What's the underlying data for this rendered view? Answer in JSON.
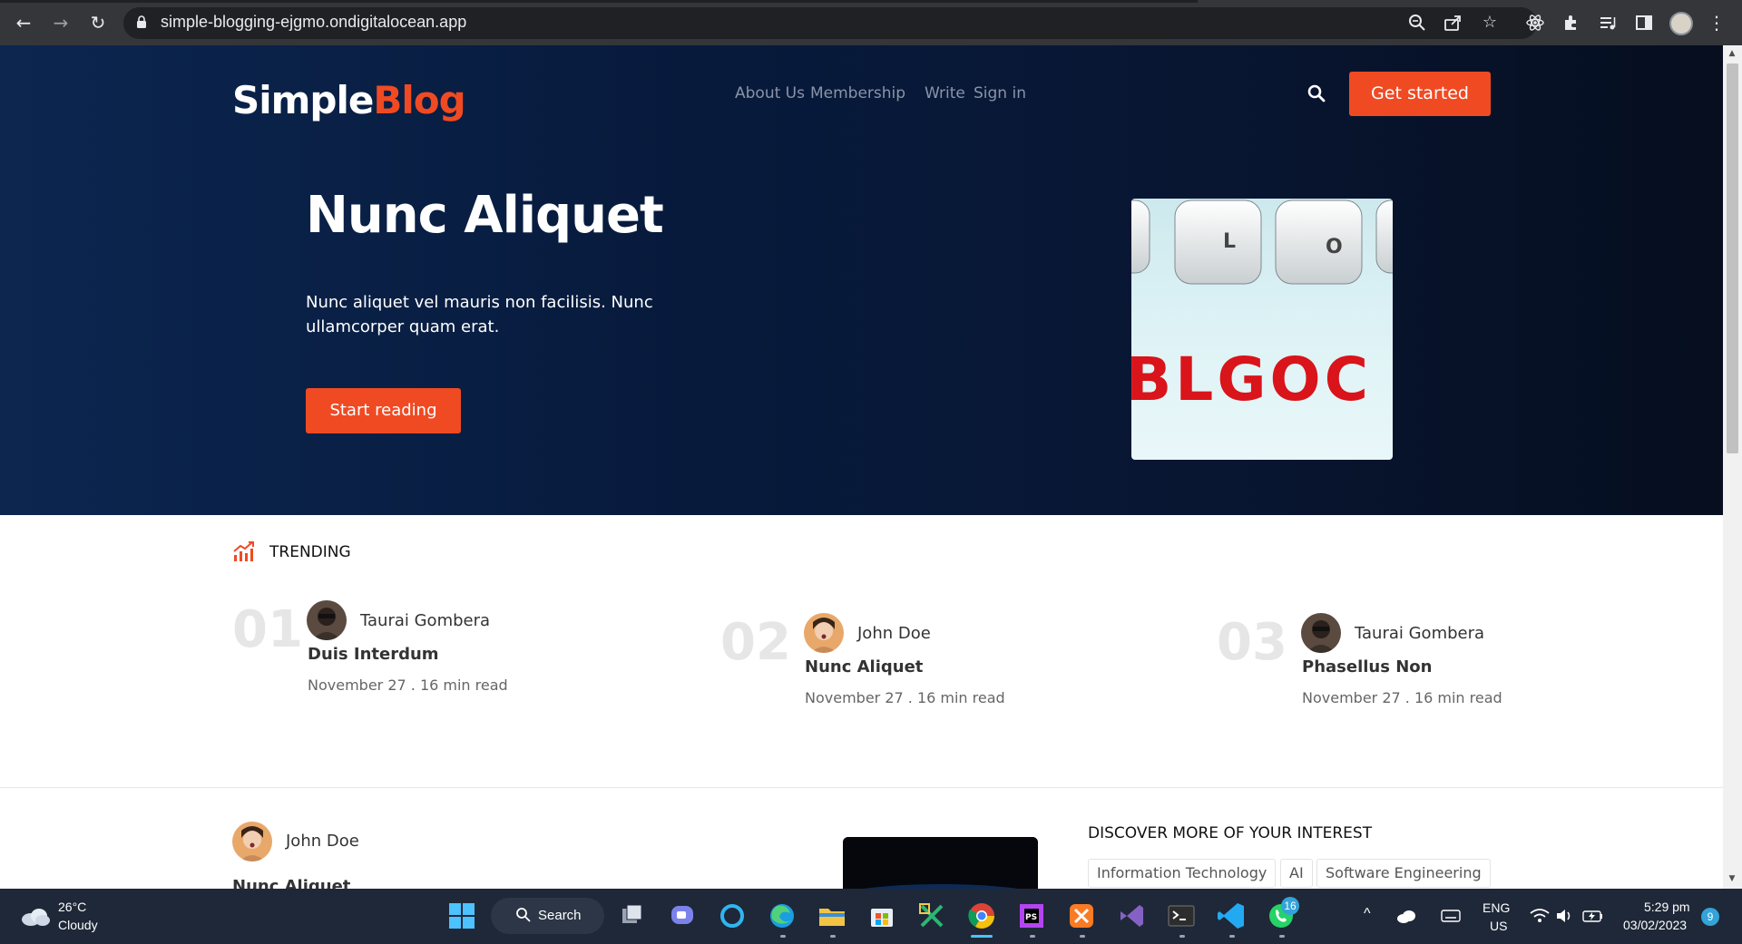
{
  "browser": {
    "url": "simple-blogging-ejgmo.ondigitalocean.app",
    "icons": [
      "back-arrow-icon",
      "forward-arrow-icon",
      "reload-icon",
      "lock-icon",
      "zoom-icon",
      "share-icon",
      "star-icon",
      "react-devtools-icon",
      "extensions-icon",
      "media-icon",
      "side-panel-icon",
      "profile-avatar-icon",
      "kebab-menu-icon"
    ]
  },
  "header": {
    "logo_part1": "Simple",
    "logo_part2": "Blog",
    "nav": [
      "About Us",
      "Membership",
      "Write",
      "Sign in"
    ],
    "cta": "Get started"
  },
  "hero": {
    "title": "Nunc Aliquet",
    "text": "Nunc aliquet vel mauris non facilisis. Nunc ullamcorper quam erat.",
    "button": "Start reading",
    "image_text_keys": [
      "L",
      "O"
    ],
    "image_text_big": "BLGOC"
  },
  "trending": {
    "label": "TRENDING",
    "items": [
      {
        "num": "01",
        "author": "Taurai Gombera",
        "title": "Duis Interdum",
        "meta": "November 27 . 16 min read"
      },
      {
        "num": "02",
        "author": "John Doe",
        "title": "Nunc Aliquet",
        "meta": "November 27 . 16 min read"
      },
      {
        "num": "03",
        "author": "Taurai Gombera",
        "title": "Phasellus Non",
        "meta": "November 27 . 16 min read"
      }
    ]
  },
  "feed": {
    "author": "John Doe",
    "title": "Nunc Aliquet"
  },
  "discover": {
    "heading": "DISCOVER MORE OF YOUR INTEREST",
    "tags": [
      "Information Technology",
      "AI",
      "Software Engineering"
    ]
  },
  "taskbar": {
    "temp": "26°C",
    "weather": "Cloudy",
    "search": "Search",
    "lang1": "ENG",
    "lang2": "US",
    "time": "5:29 pm",
    "date": "03/02/2023",
    "notif_count": "9",
    "whatsapp_count": "16"
  },
  "colors": {
    "accent": "#f04a23",
    "hero_bg": "#071a3c",
    "chrome_bg": "#35363a",
    "taskbar_bg": "#1f2838"
  }
}
